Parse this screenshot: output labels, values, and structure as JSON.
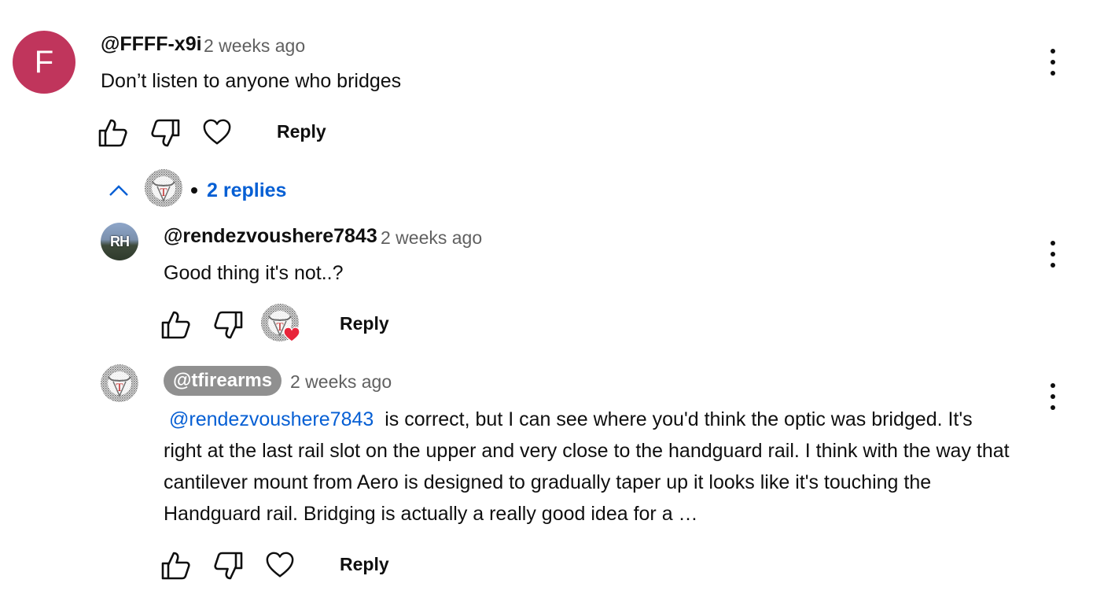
{
  "comments": [
    {
      "author": "@FFFF-x9i",
      "avatar_letter": "F",
      "time": "2 weeks ago",
      "text": "Don’t listen to anyone who bridges",
      "reply_label": "Reply"
    }
  ],
  "replies_toggle": {
    "count_label": "2 replies"
  },
  "replies": [
    {
      "author": "@rendezvoushere7843",
      "avatar_initials": "RH",
      "time": "2 weeks ago",
      "text": "Good thing it's not..?",
      "reply_label": "Reply"
    },
    {
      "author": "@tfirearms",
      "time": "2 weeks ago",
      "mention": "@rendezvoushere7843",
      "text_after_mention": " is correct, but I can see where you'd think the optic was bridged. It's right at the last rail slot on the upper and very close to the handguard rail. I think with the way that cantilever mount from Aero is designed to gradually taper up it looks like it's touching the Handguard rail. Bridging is actually a really good idea for a …",
      "reply_label": "Reply"
    }
  ],
  "colors": {
    "link_blue": "#065fd4",
    "avatar_f": "#c0355c",
    "heart_red": "#e8253a",
    "chip_bg": "#909090"
  },
  "icons": [
    "like-icon",
    "dislike-icon",
    "heart-icon",
    "chevron-up-icon",
    "more-vert-icon"
  ]
}
